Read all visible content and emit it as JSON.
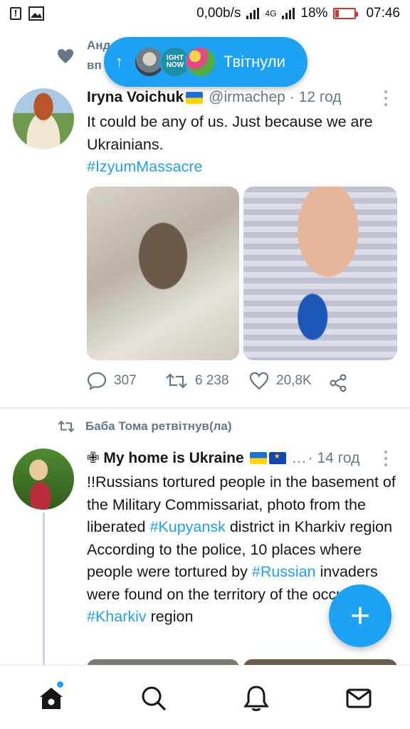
{
  "status_bar": {
    "net_speed": "0,00b/s",
    "network": "4G",
    "battery": "18%",
    "time": "07:46"
  },
  "ghost_header": {
    "line1": "Анд                              ькій",
    "line2": "вп"
  },
  "new_tweets_pill": {
    "arrow": "↑",
    "label": "Твітнули",
    "avatar2_text": "IGHT NOW"
  },
  "tweet1": {
    "author_name": "Iryna Voichuk",
    "handle": "@irmachep",
    "time": "· 12 год",
    "text": "It could be any of us. Just because we are Ukrainians.",
    "hashtag": "#IzyumMassacre",
    "replies": "307",
    "retweets": "6 238",
    "likes": "20,8K"
  },
  "tweet2": {
    "retweeted_by": "Баба Тома ретвітнув(ла)",
    "author_name": "✙ My home is Ukraine",
    "ellipsis": "…",
    "time": "· 14 год",
    "text_1": "!!Russians tortured people in the basement of the Military Commissariat, photo from the liberated ",
    "tag_1": "#Kupyansk",
    "text_2": " district in Kharkiv region",
    "text_3": "According to the police, 10 places where people were tortured by ",
    "tag_2": "#Russian",
    "text_4": " invaders were found on the territory of the occupied ",
    "tag_3": "#Kharkiv",
    "text_5": " region"
  },
  "fab": {
    "label": "+"
  },
  "colors": {
    "accent": "#1da1f2",
    "muted": "#657786"
  },
  "tabs": [
    "home-icon",
    "search-icon",
    "notifications-icon",
    "messages-icon"
  ]
}
